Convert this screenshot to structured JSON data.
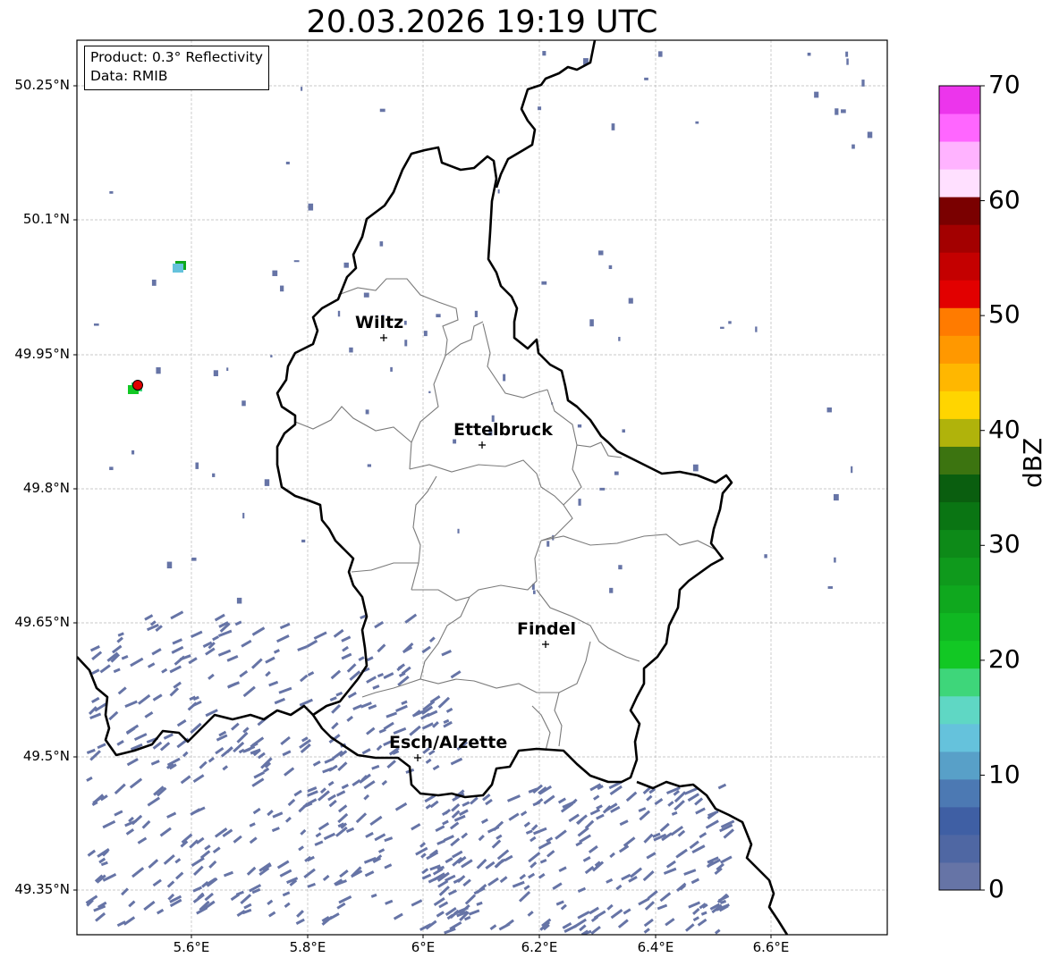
{
  "title": "20.03.2026 19:19 UTC",
  "info_box": {
    "product": "Product: 0.3° Reflectivity",
    "data": "Data: RMIB"
  },
  "lat_labels": [
    "50.25°N",
    "50.1°N",
    "49.95°N",
    "49.8°N",
    "49.65°N",
    "49.5°N",
    "49.35°N"
  ],
  "lon_labels": [
    "5.6°E",
    "5.8°E",
    "6°E",
    "6.2°E",
    "6.4°E",
    "6.6°E"
  ],
  "cities": [
    "Wiltz",
    "Ettelbruck",
    "Findel",
    "Esch/Alzette"
  ],
  "colorbar": {
    "label": "dBZ",
    "ticks": [
      "0",
      "10",
      "20",
      "30",
      "40",
      "50",
      "60",
      "70"
    ],
    "colors": [
      "#6674a6",
      "#4f67a3",
      "#3f5fa4",
      "#4c79b3",
      "#58a0c8",
      "#65c2dc",
      "#5fd7c4",
      "#3ed67a",
      "#12c824",
      "#10b822",
      "#0fa81e",
      "#0f9a1c",
      "#0d8a18",
      "#0a7513",
      "#0a5e0f",
      "#3c7410",
      "#b0b30b",
      "#ffd500",
      "#ffb700",
      "#ff9800",
      "#ff7b00",
      "#e20000",
      "#c40000",
      "#a30000",
      "#7a0000",
      "#ffe0ff",
      "#ffb3ff",
      "#ff66ff",
      "#ec35ec"
    ]
  },
  "radar_site_color": "#e00000",
  "echo_color": "#6674a6"
}
